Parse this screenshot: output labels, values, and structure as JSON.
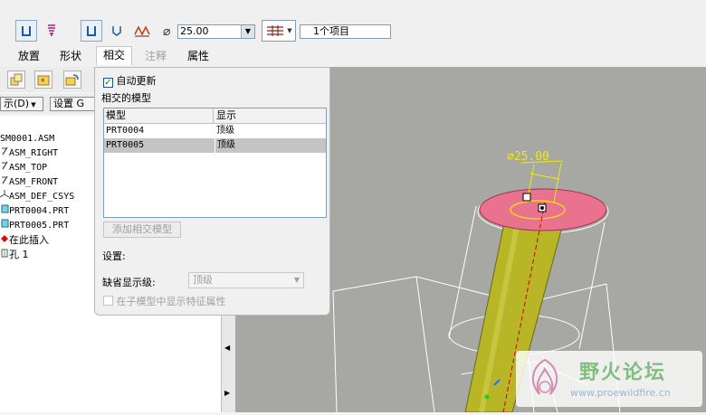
{
  "toolbar": {
    "diameter_symbol": "⌀",
    "diameter_value": "25.00",
    "intersect_items": "1个项目"
  },
  "tabs": [
    {
      "label": "放置"
    },
    {
      "label": "形状"
    },
    {
      "label": "相交"
    },
    {
      "label": "注释"
    },
    {
      "label": "属性"
    }
  ],
  "tree": {
    "show_button": "示(D)",
    "settings_button": "设置 G",
    "items": [
      {
        "label": "SM0001.ASM"
      },
      {
        "label": "ASM_RIGHT"
      },
      {
        "label": "ASM_TOP"
      },
      {
        "label": "ASM_FRONT"
      },
      {
        "label": "ASM_DEF_CSYS"
      },
      {
        "label": "PRT0004.PRT"
      },
      {
        "label": "PRT0005.PRT"
      },
      {
        "label": "在此插入"
      },
      {
        "label": "孔 1"
      }
    ]
  },
  "panel": {
    "auto_update": "自动更新",
    "intersect_models": "相交的模型",
    "columns": [
      "模型",
      "显示"
    ],
    "rows": [
      {
        "model": "PRT0004",
        "display": "顶级"
      },
      {
        "model": "PRT0005",
        "display": "顶级"
      }
    ],
    "add_button": "添加相交模型",
    "settings_label": "设置",
    "default_level_label": "缺省显示级",
    "default_level_value": "顶级",
    "show_in_sub": "在子模型中显示特征属性"
  },
  "viewport": {
    "dim_label": "⌀25.00"
  },
  "watermark": {
    "text": "野火论坛",
    "url": "www.proewildfire.cn"
  },
  "colors": {
    "cylinder": "#b8b526",
    "hole_top": "#e9738e",
    "dimension": "#f2ea00",
    "axis": "#cc0000"
  }
}
